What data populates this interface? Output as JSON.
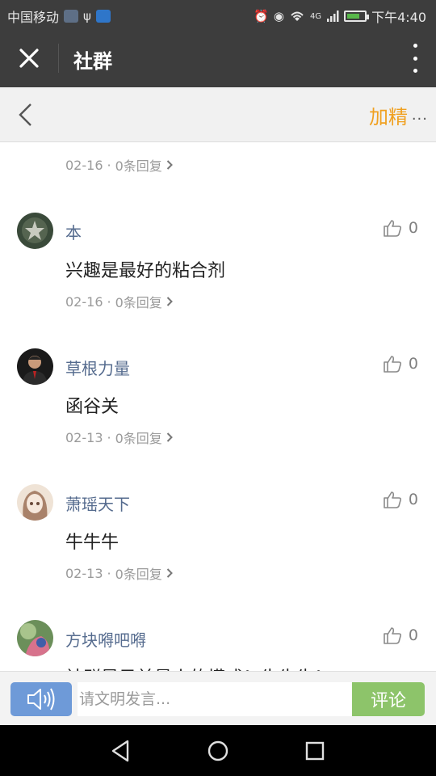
{
  "status_bar": {
    "carrier": "中国移动",
    "usb_icon": "usb-icon",
    "time": "下午4:40",
    "network": "4G",
    "battery_level": 0.68
  },
  "title_bar": {
    "title": "社群",
    "close_icon": "close-icon",
    "menu_icon": "more-vertical-icon"
  },
  "sub_header": {
    "back_icon": "chevron-left-icon",
    "feature_label": "加精",
    "more_label": "..."
  },
  "first_item": {
    "date": "02-16",
    "sep": "·",
    "replies": "0条回复"
  },
  "comments": [
    {
      "name": "本",
      "text": "兴趣是最好的粘合剂",
      "date": "02-16",
      "sep": "·",
      "replies": "0条回复",
      "likes": "0"
    },
    {
      "name": "草根力量",
      "text": "函谷关",
      "date": "02-13",
      "sep": "·",
      "replies": "0条回复",
      "likes": "0"
    },
    {
      "name": "萧瑶天下",
      "text": "牛牛牛",
      "date": "02-13",
      "sep": "·",
      "replies": "0条回复",
      "likes": "0"
    },
    {
      "name": "方块嘚吧嘚",
      "text": "社群是目前最火的模式！牛牛牛！",
      "likes": "0"
    }
  ],
  "input_bar": {
    "voice_icon": "speaker-icon",
    "placeholder": "请文明发言...",
    "submit_label": "评论"
  },
  "nav_bar": {
    "back_icon": "nav-back-icon",
    "home_icon": "nav-home-icon",
    "recents_icon": "nav-recents-icon"
  },
  "colors": {
    "header_bg": "#3d3d3d",
    "accent_orange": "#f0a020",
    "name_blue": "#556b8e",
    "submit_green": "#8dc46a",
    "voice_blue": "#6e9ad8"
  }
}
